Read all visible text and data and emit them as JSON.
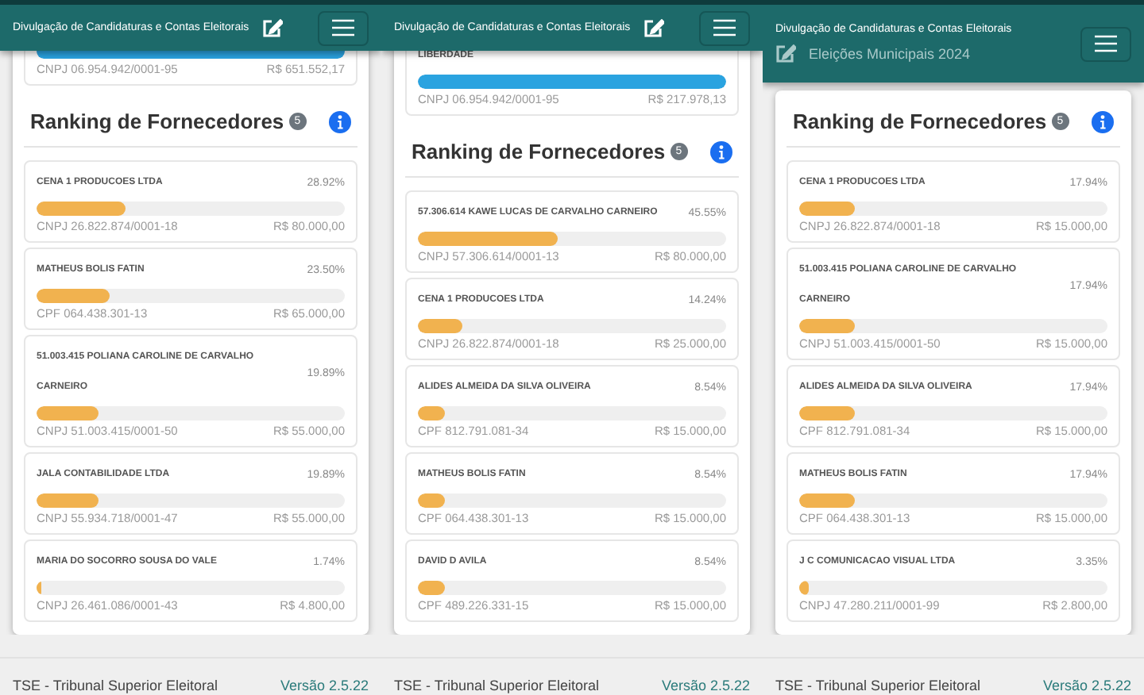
{
  "panels": [
    {
      "header": {
        "title": "Divulgação de Candidaturas e Contas Eleitorais"
      },
      "top_item": {
        "document": "CNPJ 06.954.942/0001-95",
        "amount": "R$ 651.552,17",
        "level": 1
      },
      "ranking": {
        "title": "Ranking de Fornecedores",
        "count": "5"
      },
      "suppliers": [
        {
          "name": "CENA 1 PRODUCOES LTDA",
          "share": "28.92%",
          "level": 0.2892,
          "document": "CNPJ 26.822.874/0001-18",
          "amount": "R$ 80.000,00"
        },
        {
          "name": "MATHEUS BOLIS FATIN",
          "share": "23.50%",
          "level": 0.235,
          "document": "CPF 064.438.301-13",
          "amount": "R$ 65.000,00"
        },
        {
          "name": "51.003.415 POLIANA CAROLINE DE CARVALHO CARNEIRO",
          "share": "19.89%",
          "level": 0.1989,
          "document": "CNPJ 51.003.415/0001-50",
          "amount": "R$ 55.000,00"
        },
        {
          "name": "JALA CONTABILIDADE LTDA",
          "share": "19.89%",
          "level": 0.1989,
          "document": "CNPJ 55.934.718/0001-47",
          "amount": "R$ 55.000,00"
        },
        {
          "name": "MARIA DO SOCORRO SOUSA DO VALE",
          "share": "1.74%",
          "level": 0.0174,
          "document": "CNPJ 26.461.086/0001-43",
          "amount": "R$ 4.800,00"
        }
      ],
      "footer": {
        "org": "TSE - Tribunal Superior Eleitoral",
        "version": "Versão 2.5.22"
      }
    },
    {
      "header": {
        "title": "Divulgação de Candidaturas e Contas Eleitorais"
      },
      "top_item": {
        "name": "LIBERDADE",
        "document": "CNPJ 06.954.942/0001-95",
        "amount": "R$ 217.978,13",
        "level": 1
      },
      "ranking": {
        "title": "Ranking de Fornecedores",
        "count": "5"
      },
      "suppliers": [
        {
          "name": "57.306.614 KAWE LUCAS DE CARVALHO CARNEIRO",
          "share": "45.55%",
          "level": 0.4555,
          "document": "CNPJ 57.306.614/0001-13",
          "amount": "R$ 80.000,00"
        },
        {
          "name": "CENA 1 PRODUCOES LTDA",
          "share": "14.24%",
          "level": 0.1424,
          "document": "CNPJ 26.822.874/0001-18",
          "amount": "R$ 25.000,00"
        },
        {
          "name": "ALIDES ALMEIDA DA SILVA OLIVEIRA",
          "share": "8.54%",
          "level": 0.0854,
          "document": "CPF 812.791.081-34",
          "amount": "R$ 15.000,00"
        },
        {
          "name": "MATHEUS BOLIS FATIN",
          "share": "8.54%",
          "level": 0.0854,
          "document": "CPF 064.438.301-13",
          "amount": "R$ 15.000,00"
        },
        {
          "name": "DAVID D AVILA",
          "share": "8.54%",
          "level": 0.0854,
          "document": "CPF 489.226.331-15",
          "amount": "R$ 15.000,00"
        }
      ],
      "footer": {
        "org": "TSE - Tribunal Superior Eleitoral",
        "version": "Versão 2.5.22"
      }
    },
    {
      "header": {
        "title": "Divulgação de Candidaturas e Contas Eleitorais",
        "subtitle": "Eleições Municipais 2024"
      },
      "ranking": {
        "title": "Ranking de Fornecedores",
        "count": "5"
      },
      "suppliers": [
        {
          "name": "CENA 1 PRODUCOES LTDA",
          "share": "17.94%",
          "level": 0.1794,
          "document": "CNPJ 26.822.874/0001-18",
          "amount": "R$ 15.000,00"
        },
        {
          "name": "51.003.415 POLIANA CAROLINE DE CARVALHO CARNEIRO",
          "share": "17.94%",
          "level": 0.1794,
          "document": "CNPJ 51.003.415/0001-50",
          "amount": "R$ 15.000,00"
        },
        {
          "name": "ALIDES ALMEIDA DA SILVA OLIVEIRA",
          "share": "17.94%",
          "level": 0.1794,
          "document": "CPF 812.791.081-34",
          "amount": "R$ 15.000,00"
        },
        {
          "name": "MATHEUS BOLIS FATIN",
          "share": "17.94%",
          "level": 0.1794,
          "document": "CPF 064.438.301-13",
          "amount": "R$ 15.000,00"
        },
        {
          "name": "J C COMUNICACAO VISUAL LTDA",
          "share": "3.35%",
          "level": 0.0335,
          "document": "CNPJ 47.280.211/0001-99",
          "amount": "R$ 2.800,00"
        }
      ],
      "footer": {
        "org": "TSE - Tribunal Superior Eleitoral",
        "version": "Versão 2.5.22"
      }
    }
  ]
}
